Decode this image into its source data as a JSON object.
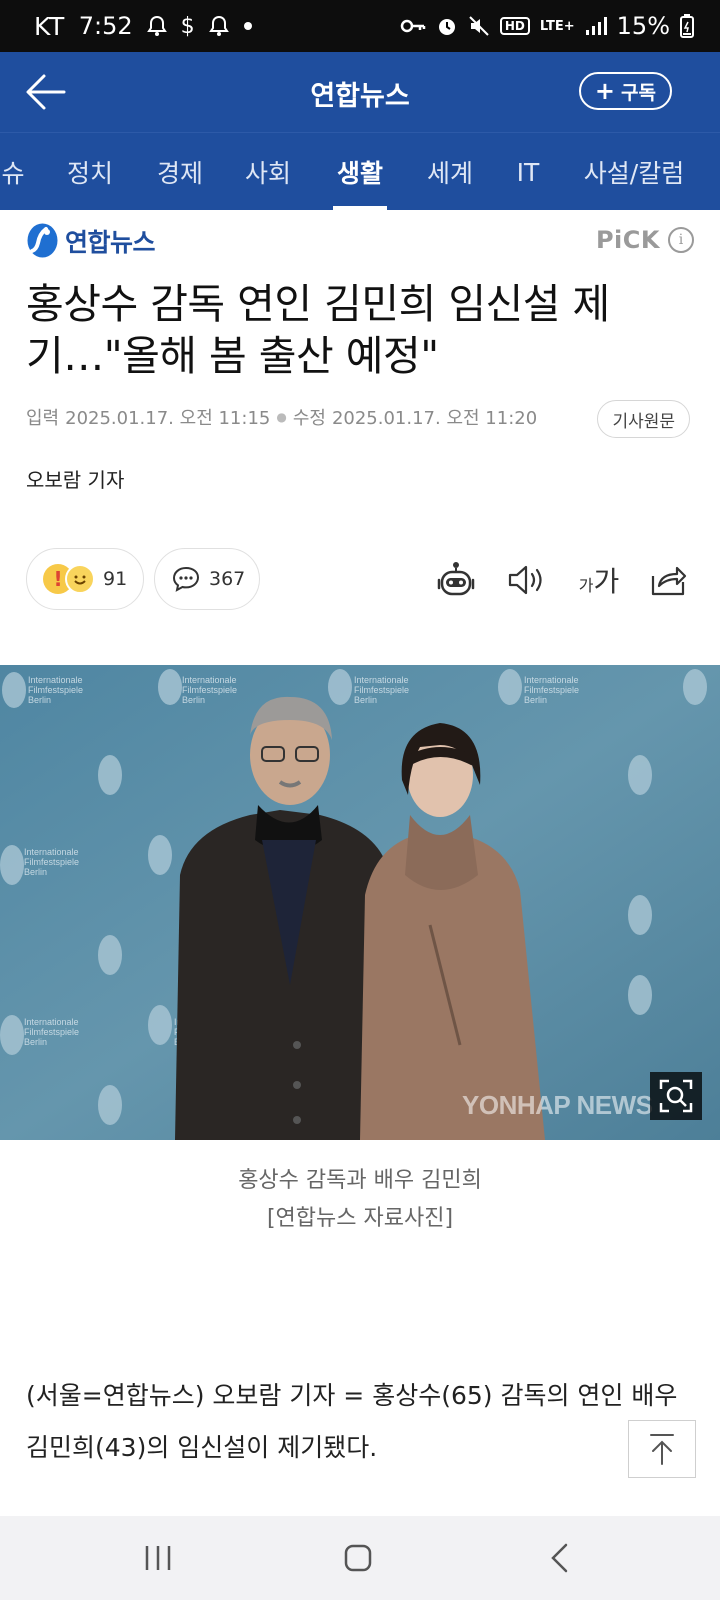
{
  "status_bar": {
    "carrier": "KT",
    "time": "7:52",
    "battery": "15%",
    "network": "LTE+",
    "hd": "HD",
    "left_icons": [
      "bell-icon",
      "dollar-icon",
      "bell-icon",
      "dot-icon"
    ],
    "right_icons": [
      "key-icon",
      "alarm-icon",
      "mute-icon",
      "hd-icon",
      "lte-icon",
      "signal-icon",
      "battery-icon"
    ]
  },
  "header": {
    "title": "연합뉴스",
    "subscribe_label": "구독",
    "bg_color": "#1f4e9e"
  },
  "tabs": [
    {
      "label": "슈"
    },
    {
      "label": "정치"
    },
    {
      "label": "경제"
    },
    {
      "label": "사회"
    },
    {
      "label": "생활",
      "active": true
    },
    {
      "label": "세계"
    },
    {
      "label": "IT"
    },
    {
      "label": "사설/칼럼"
    }
  ],
  "article": {
    "brand": "연합뉴스",
    "pick_label": "PiCK",
    "headline": "홍상수 감독 연인 김민희 임신설 제기…\"올해 봄 출산 예정\"",
    "published_label": "입력",
    "published": "2025.01.17. 오전 11:15",
    "modified_label": "수정",
    "modified": "2025.01.17. 오전 11:20",
    "original_button": "기사원문",
    "reporter": "오보람 기자",
    "reaction_count": "91",
    "comment_count": "367",
    "photo_watermark": "YONHAP NEWS",
    "caption_line1": "홍상수 감독과 배우 김민희",
    "caption_line2": "[연합뉴스 자료사진]",
    "body": "(서울=연합뉴스) 오보람 기자 = 홍상수(65) 감독의 연인 배우 김민희(43)의 임신설이 제기됐다."
  },
  "colors": {
    "brand_blue": "#1f4e9e",
    "status_bar": "#0d0d0d",
    "meta_gray": "#8a8a8a"
  }
}
